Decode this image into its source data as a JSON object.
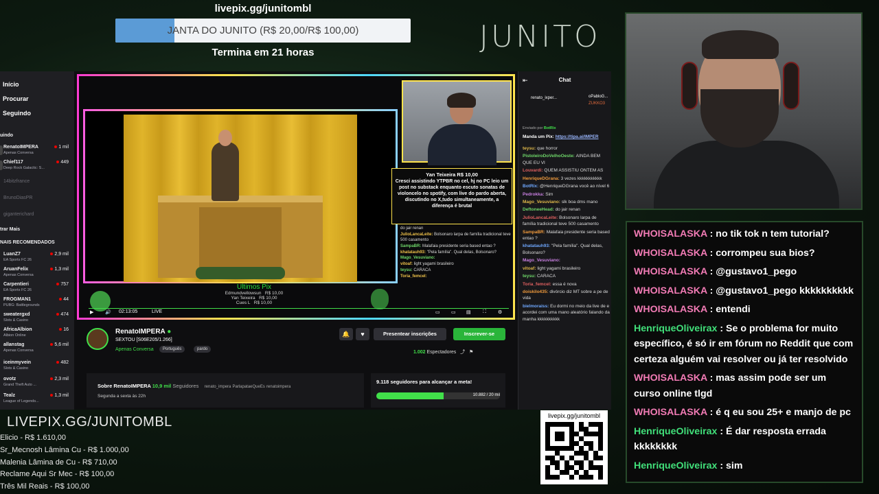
{
  "goal": {
    "url": "livepix.gg/junitombl",
    "text": "JANTA DO JUNITO (R$ 20,00/R$ 100,00)",
    "progress": 0.2,
    "ends": "Termina em 21 horas"
  },
  "logo": "JUNITO",
  "twitch": {
    "nav": [
      "Início",
      "Procurar",
      "Seguindo"
    ],
    "followed_heading": "uindo",
    "followed": [
      {
        "name": "RenatoIMPERA",
        "game": "Apenas Conversa",
        "viewers": "1 mil",
        "live": true
      },
      {
        "name": "Chief117",
        "game": "Deep Rock Galactic: S...",
        "viewers": "449",
        "live": true
      },
      {
        "name": "14bitzfrance",
        "game": "",
        "viewers": "",
        "live": false
      },
      {
        "name": "BrunoDiasPR",
        "game": "",
        "viewers": "",
        "live": false
      },
      {
        "name": "giganterichard",
        "game": "",
        "viewers": "",
        "live": false
      }
    ],
    "show_more": "trar Mais",
    "recommended_heading": "NAIS RECOMENDADOS",
    "recommended": [
      {
        "name": "LuanZ7",
        "game": "EA Sports FC 26",
        "viewers": "2,9 mil"
      },
      {
        "name": "AruanFelix",
        "game": "Apenas Conversa",
        "viewers": "1,3 mil"
      },
      {
        "name": "Carpentieri",
        "game": "EA Sports FC 26",
        "viewers": "757"
      },
      {
        "name": "FROGMAN1",
        "game": "PUBG: Battlegrounds",
        "viewers": "44"
      },
      {
        "name": "sweatergxd",
        "game": "Slots & Casino",
        "viewers": "474"
      },
      {
        "name": "AfricaAlbion",
        "game": "Albion Online",
        "viewers": "16"
      },
      {
        "name": "allanstag",
        "game": "Apenas Conversa",
        "viewers": "5,6 mil"
      },
      {
        "name": "iceinmyvein",
        "game": "Slots & Casino",
        "viewers": "482"
      },
      {
        "name": "ovotz",
        "game": "Grand Theft Auto ...",
        "viewers": "2,3 mil"
      },
      {
        "name": "Tealz",
        "game": "League of Legends...",
        "viewers": "1,3 mil"
      }
    ],
    "player": {
      "donation_name": "Yan Teixeira R$ 10,00",
      "donation_text": "Cresci assistindo YTPBR no cel, hj no PC leio um post no substack enquanto escuto sonatas de violoncelo no spotify, com live do pardo aberta, discutindo no X,tudo simultaneamente, a diferença é brutal",
      "last_pix_title": "Ultimos Pix",
      "last_pix": [
        {
          "name": "Edmundvellowsun",
          "value": "R$ 10,00"
        },
        {
          "name": "Yan Teixeira",
          "value": "R$ 10,00"
        },
        {
          "name": "Cues L",
          "value": "R$ 10,00"
        }
      ],
      "overlay_chat": [
        {
          "user": "",
          "text": "do jair renan"
        },
        {
          "user": "JulioLancaLeite",
          "text": "Bolsonaro larpa de família tradicional teve 500 casamento"
        },
        {
          "user": "SampaBR",
          "text": "Malafaia presidente seria based entao ?"
        },
        {
          "user": "khatatauh93",
          "text": "\"Pela família\". Qual delas, Bolsonaro?"
        },
        {
          "user": "Mago_Vesuviano",
          "text": ""
        },
        {
          "user": "vitoaf",
          "text": "light yagami brasileiro"
        },
        {
          "user": "teysu",
          "text": "CARACA"
        },
        {
          "user": "Toria_femcel",
          "text": ""
        }
      ],
      "time": "02:13:05",
      "live_label": "LIVE"
    },
    "info": {
      "channel": "RenatoIMPERA",
      "title": "SEXTOU [S06E205/1.266]",
      "category": "Apenas Conversa",
      "tags": [
        "Português",
        "pardo"
      ],
      "present_label": "Presentear inscrições",
      "subscribe_label": "Inscrever-se",
      "viewers": "1.002",
      "viewers_label": "Espectadores",
      "about": "Sobre RenatoIMPERA",
      "followers": "10,9 mil",
      "followers_label": "Seguidores",
      "socials": [
        "renato_impera",
        "ParlapataeQueEs",
        "renatoimpera"
      ],
      "schedule": "Segunda a sexta às 22h",
      "goal_text": "9.118 seguidores para alcançar a meta!",
      "goal_value": "10.882 / 20 mil",
      "goal_progress": 0.544
    },
    "chat": {
      "title": "Chat",
      "top_users": [
        "renato_ixper...",
        "oPabloG...",
        "ZUKKO3"
      ],
      "pinned_by": "Enviado por",
      "pinned_user": "BotRix",
      "pinned_text": "Manda um Pix:",
      "pinned_link": "https://tipa.ai/IMPER",
      "messages": [
        {
          "user": "teysu",
          "text": "que horror"
        },
        {
          "user": "PistoleiroDoVelhoOeste",
          "text": "AINDA BEM QUE EU VI"
        },
        {
          "user": "Louvardi",
          "text": "QUEM ASSISTIU ONTEM AS"
        },
        {
          "user": "HenriqueDGrana",
          "text": "3 vezes kkkkkkkkkkk"
        },
        {
          "user": "BotRix",
          "text": "@HenriqueDGrana você ao nível 6"
        },
        {
          "user": "Pedrokka",
          "text": "Sim"
        },
        {
          "user": "Mago_Vesuviano",
          "text": "slk boa dms mano"
        },
        {
          "user": "DeftoneeHead",
          "text": "do jair renan"
        },
        {
          "user": "JulioLancaLeite",
          "text": "Bolsonaro larpa de família tradicional teve 500 casamento"
        },
        {
          "user": "SampaBR",
          "text": "Malafaia presidente seria based entao ?"
        },
        {
          "user": "khatatauh93",
          "text": "\"Pela família\". Qual delas, Bolsonaro?"
        },
        {
          "user": "Mago_Vesuviano",
          "text": ""
        },
        {
          "user": "vitoaf",
          "text": "light yagami brasileiro"
        },
        {
          "user": "teysu",
          "text": "CARACA"
        },
        {
          "user": "Toria_femcel",
          "text": "essa é nova"
        },
        {
          "user": "doiskilo435",
          "text": "divórcio diz MT sobre a pe de vida"
        },
        {
          "user": "bielmoraiss",
          "text": "Eu dormi no meio da live de e acordei com uma mano aleatório falando da manha kkkkkkkkkk"
        }
      ]
    }
  },
  "bottom_left": {
    "url": "LIVEPIX.GG/JUNITOMBL",
    "donors": [
      "Elicio - R$ 1.610,00",
      "Sr_Mecnosh Lâmina Cu - R$ 1.000,00",
      "Malenia Lâmina de Cu - R$ 710,00",
      "Reclame Aqui Sr Mec - R$ 100,00",
      "Três Mil Reais - R$ 100,00"
    ]
  },
  "qr": {
    "label": "livepix.gg/junitombl"
  },
  "right_chat": [
    {
      "user": "WHOISALASKA",
      "color": "#f27bb5",
      "text": "no tik tok n tem tutorial?"
    },
    {
      "user": "WHOISALASKA",
      "color": "#f27bb5",
      "text": "corrompeu sua bios?"
    },
    {
      "user": "WHOISALASKA",
      "color": "#f27bb5",
      "text": "@gustavo1_pego"
    },
    {
      "user": "WHOISALASKA",
      "color": "#f27bb5",
      "text": "@gustavo1_pego kkkkkkkkkk"
    },
    {
      "user": "WHOISALASKA",
      "color": "#f27bb5",
      "text": "entendi"
    },
    {
      "user": "HenriqueOliveirax",
      "color": "#41e07a",
      "text": "Se o problema for muito específico, é só ir em fórum no Reddit que com certeza alguém vai resolver ou já ter resolvido"
    },
    {
      "user": "WHOISALASKA",
      "color": "#f27bb5",
      "text": "mas assim pode ser um curso online tlgd"
    },
    {
      "user": "WHOISALASKA",
      "color": "#f27bb5",
      "text": "é q eu sou 25+ e manjo de pc"
    },
    {
      "user": "HenriqueOliveirax",
      "color": "#41e07a",
      "text": "É dar resposta errada kkkkkkkk"
    },
    {
      "user": "HenriqueOliveirax",
      "color": "#41e07a",
      "text": "sim"
    }
  ]
}
